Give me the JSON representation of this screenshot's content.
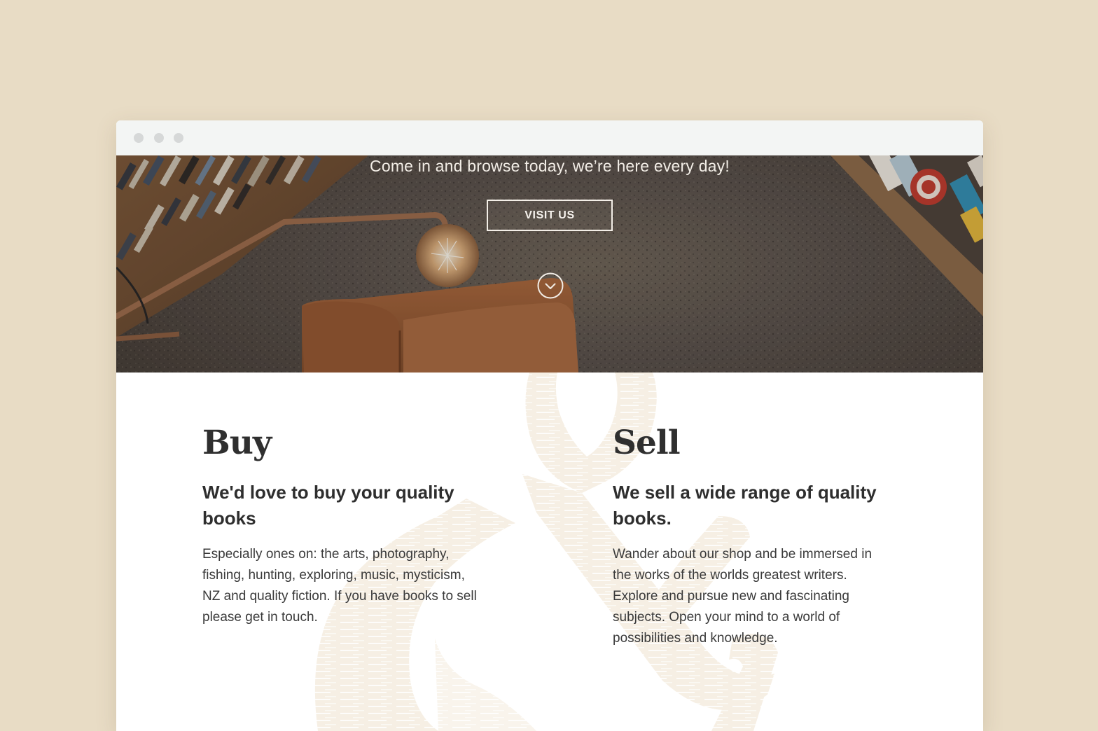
{
  "window": {
    "dots": [
      "close",
      "minimize",
      "maximize"
    ]
  },
  "hero": {
    "tagline": "Come in and browse today, we’re here every day!",
    "cta_label": "VISIT US",
    "scroll_icon": "chevron-down-circle-icon"
  },
  "buy": {
    "title": "Buy",
    "subtitle": "We'd love to buy your quality books",
    "body": "Especially ones on: the arts, photography, fishing, hunting, exploring, music, mysticism, NZ and quality fiction. If you have books to sell please get in touch."
  },
  "sell": {
    "title": "Sell",
    "subtitle": "We sell a wide range of quality books.",
    "body": "Wander about our shop and be immersed in the works of the worlds greatest writers. Explore and pursue new and fascinating subjects. Open your mind to a world of possibilities and knowledge."
  },
  "colors": {
    "page_background": "#e8dcc5",
    "chrome": "#f3f5f4",
    "ampersand": "#f4ece0",
    "text_dark": "#2f2f2f"
  }
}
